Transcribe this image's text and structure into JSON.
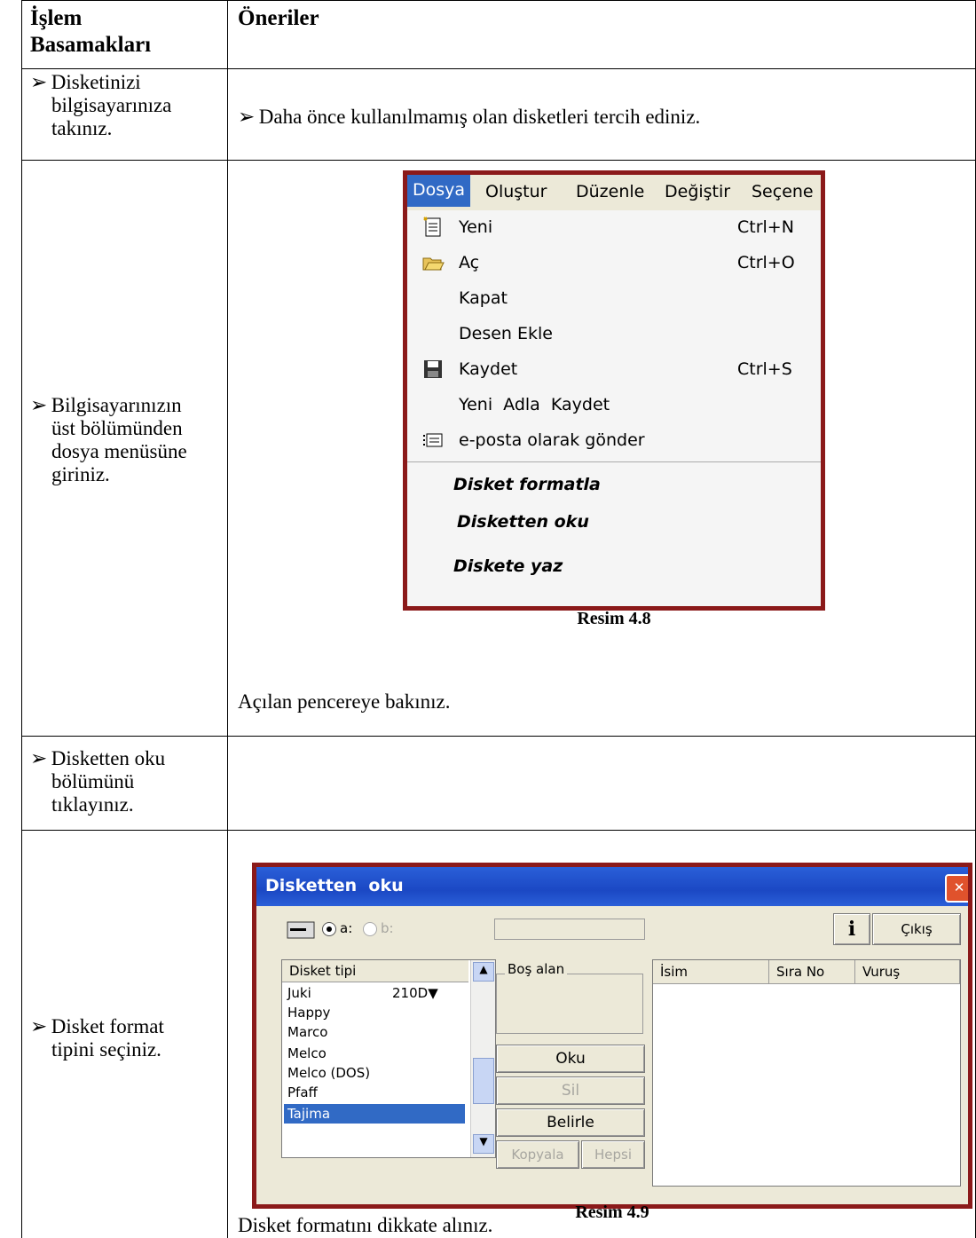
{
  "header": {
    "col1_line1": "İşlem",
    "col1_line2": "Basamakları",
    "col2": "Öneriler"
  },
  "rows": [
    {
      "step": [
        "Disketinizi",
        "bilgisayarınıza",
        "takınız."
      ],
      "advice": "Daha önce kullanılmamış olan disketleri tercih ediniz."
    },
    {
      "step": [
        "Bilgisayarınızın",
        "üst bölümünden",
        "dosya menüsüne",
        "giriniz."
      ],
      "caption": "Resim 4.8",
      "note": "Açılan pencereye bakınız."
    },
    {
      "step": [
        "Disketten oku",
        "bölümünü",
        "tıklayınız."
      ]
    },
    {
      "step": [
        "Disket format",
        "tipini seçiniz."
      ],
      "caption": "Resim 4.9",
      "note": "Disket formatını dikkate alınız."
    }
  ],
  "menu_shot": {
    "menubar": [
      "Dosya",
      "Oluştur",
      "Düzenle",
      "Değiştir",
      "Seçene"
    ],
    "items": [
      {
        "label": "Yeni",
        "shortcut": "Ctrl+N",
        "icon": "new-document-icon"
      },
      {
        "label": "Aç",
        "shortcut": "Ctrl+O",
        "icon": "open-folder-icon"
      },
      {
        "label": "Kapat",
        "shortcut": ""
      },
      {
        "label": "Desen Ekle",
        "shortcut": ""
      },
      {
        "label": "Kaydet",
        "shortcut": "Ctrl+S",
        "icon": "save-disk-icon"
      },
      {
        "label": "Yeni  Adla  Kaydet",
        "shortcut": ""
      },
      {
        "label": "e-posta olarak gönder",
        "shortcut": "",
        "icon": "email-icon"
      }
    ],
    "extra_items": [
      "Disket formatla",
      "Disketten oku",
      "Diskete yaz"
    ],
    "accent": "#316ac5",
    "frame_color": "#8b1a1a"
  },
  "dialog_shot": {
    "title": "Disketten  oku",
    "drive_a": "a:",
    "drive_b": "b:",
    "exit_label": "Çıkış",
    "info_label": "i",
    "free_space_label": "Boş alan",
    "list_header": "Disket tipi",
    "list_items": [
      "Juki",
      "Happy",
      "Marco",
      "Melco",
      "Melco (DOS)",
      "Pfaff",
      "Tajima"
    ],
    "selected_item": "Tajima",
    "juki_model": "210D",
    "buttons": {
      "read": "Oku",
      "delete": "Sil",
      "define": "Belirle",
      "copy": "Kopyala",
      "all": "Hepsi"
    },
    "columns": [
      "İsim",
      "Sıra No",
      "Vuruş"
    ]
  }
}
